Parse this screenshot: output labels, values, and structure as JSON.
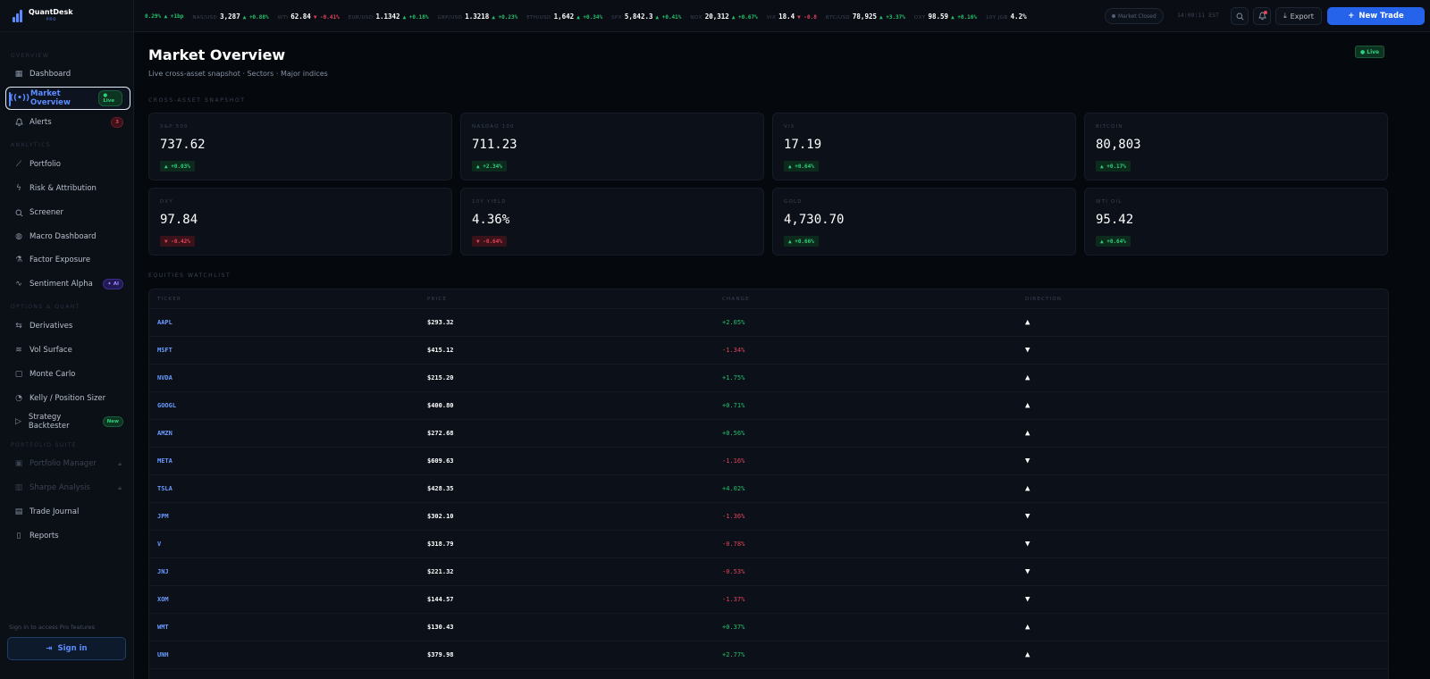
{
  "brand": {
    "name": "QuantDesk",
    "tier": "PRO"
  },
  "sidebar": {
    "sections": [
      "Overview",
      "Analytics",
      "Options & Quant",
      "Portfolio Suite"
    ],
    "items": [
      {
        "label": "Dashboard",
        "icon": "grid-icon"
      },
      {
        "label": "Market Overview",
        "icon": "broadcast-icon",
        "badge": "Live"
      },
      {
        "label": "Alerts",
        "icon": "bell-icon",
        "badge": "3"
      },
      {
        "label": "Portfolio",
        "icon": "trend-line-icon"
      },
      {
        "label": "Risk & Attribution",
        "icon": "bolt-icon"
      },
      {
        "label": "Screener",
        "icon": "search-icon"
      },
      {
        "label": "Macro Dashboard",
        "icon": "globe-icon"
      },
      {
        "label": "Factor Exposure",
        "icon": "flask-icon"
      },
      {
        "label": "Sentiment Alpha",
        "icon": "pulse-icon",
        "badge": "AI"
      },
      {
        "label": "Derivatives",
        "icon": "sliders-icon"
      },
      {
        "label": "Vol Surface",
        "icon": "wave-icon"
      },
      {
        "label": "Monte Carlo",
        "icon": "square-icon"
      },
      {
        "label": "Kelly / Position Sizer",
        "icon": "gauge-icon"
      },
      {
        "label": "Strategy Backtester",
        "icon": "play-icon",
        "badge": "New"
      },
      {
        "label": "Portfolio Manager",
        "icon": "briefcase-icon"
      },
      {
        "label": "Sharpe Analysis",
        "icon": "chart-icon"
      },
      {
        "label": "Trade Journal",
        "icon": "book-icon"
      },
      {
        "label": "Reports",
        "icon": "document-icon"
      }
    ],
    "signin_note": "Sign in to access Pro features",
    "signin_label": "Sign in"
  },
  "ticker": [
    {
      "sym": "",
      "px": "",
      "ch": "0.29% ▲ +1bp",
      "dir": "up"
    },
    {
      "sym": "NAS/USD",
      "px": "3,287",
      "ch": "▲ +0.88%",
      "dir": "up"
    },
    {
      "sym": "WTI",
      "px": "62.84",
      "ch": "▼ -0.41%",
      "dir": "dn"
    },
    {
      "sym": "EUR/USD",
      "px": "1.1342",
      "ch": "▲ +0.18%",
      "dir": "up"
    },
    {
      "sym": "GBP/USD",
      "px": "1.3218",
      "ch": "▲ +0.23%",
      "dir": "up"
    },
    {
      "sym": "ETH/USD",
      "px": "1,642",
      "ch": "▲ +0.34%",
      "dir": "up"
    },
    {
      "sym": "SPX",
      "px": "5,842.3",
      "ch": "▲ +0.41%",
      "dir": "up"
    },
    {
      "sym": "NDX",
      "px": "20,312",
      "ch": "▲ +0.67%",
      "dir": "up"
    },
    {
      "sym": "VIX",
      "px": "18.4",
      "ch": "▼ -0.8",
      "dir": "dn"
    },
    {
      "sym": "BTC/USD",
      "px": "78,925",
      "ch": "▲ +3.37%",
      "dir": "up"
    },
    {
      "sym": "DXY",
      "px": "98.59",
      "ch": "▲ +0.16%",
      "dir": "up"
    },
    {
      "sym": "10Y JGB",
      "px": "4.2%",
      "ch": "",
      "dir": "up"
    }
  ],
  "topbar": {
    "market_status": "Market Closed",
    "clock": "14:09:11 EST",
    "export_label": "Export",
    "new_trade_label": "New Trade"
  },
  "page": {
    "title": "Market Overview",
    "subtitle": "Live cross-asset snapshot · Sectors · Major indices",
    "live_label": "Live",
    "snapshot_label": "Cross-Asset Snapshot",
    "watchlist_label": "Equities Watchlist"
  },
  "cards": [
    {
      "label": "S&P 500",
      "value": "737.62",
      "change": "▲ +0.03%",
      "dir": "up"
    },
    {
      "label": "NASDAQ 100",
      "value": "711.23",
      "change": "▲ +2.34%",
      "dir": "up"
    },
    {
      "label": "VIX",
      "value": "17.19",
      "change": "▲ +0.64%",
      "dir": "up"
    },
    {
      "label": "Bitcoin",
      "value": "80,803",
      "change": "▲ +0.17%",
      "dir": "up"
    },
    {
      "label": "DXY",
      "value": "97.84",
      "change": "▼ -0.42%",
      "dir": "dn"
    },
    {
      "label": "10Y Yield",
      "value": "4.36%",
      "change": "▼ -0.64%",
      "dir": "dn"
    },
    {
      "label": "Gold",
      "value": "4,730.70",
      "change": "▲ +0.66%",
      "dir": "up"
    },
    {
      "label": "WTI Oil",
      "value": "95.42",
      "change": "▲ +0.64%",
      "dir": "up"
    }
  ],
  "watchlist": {
    "headers": [
      "Ticker",
      "Price",
      "Change",
      "Direction"
    ],
    "rows": [
      {
        "ticker": "AAPL",
        "price": "$293.32",
        "change": "+2.05%",
        "dir": "up"
      },
      {
        "ticker": "MSFT",
        "price": "$415.12",
        "change": "-1.34%",
        "dir": "dn"
      },
      {
        "ticker": "NVDA",
        "price": "$215.20",
        "change": "+1.75%",
        "dir": "up"
      },
      {
        "ticker": "GOOGL",
        "price": "$400.80",
        "change": "+0.71%",
        "dir": "up"
      },
      {
        "ticker": "AMZN",
        "price": "$272.68",
        "change": "+0.56%",
        "dir": "up"
      },
      {
        "ticker": "META",
        "price": "$609.63",
        "change": "-1.16%",
        "dir": "dn"
      },
      {
        "ticker": "TSLA",
        "price": "$428.35",
        "change": "+4.02%",
        "dir": "up"
      },
      {
        "ticker": "JPM",
        "price": "$302.10",
        "change": "-1.36%",
        "dir": "dn"
      },
      {
        "ticker": "V",
        "price": "$318.79",
        "change": "-0.78%",
        "dir": "dn"
      },
      {
        "ticker": "JNJ",
        "price": "$221.32",
        "change": "-0.53%",
        "dir": "dn"
      },
      {
        "ticker": "XOM",
        "price": "$144.57",
        "change": "-1.37%",
        "dir": "dn"
      },
      {
        "ticker": "WMT",
        "price": "$130.43",
        "change": "+0.37%",
        "dir": "up"
      },
      {
        "ticker": "UNH",
        "price": "$379.98",
        "change": "+2.77%",
        "dir": "up"
      }
    ]
  },
  "colors": {
    "accent": "#2563eb",
    "up": "#23c16b",
    "down": "#e2435a",
    "background": "#05080d"
  }
}
